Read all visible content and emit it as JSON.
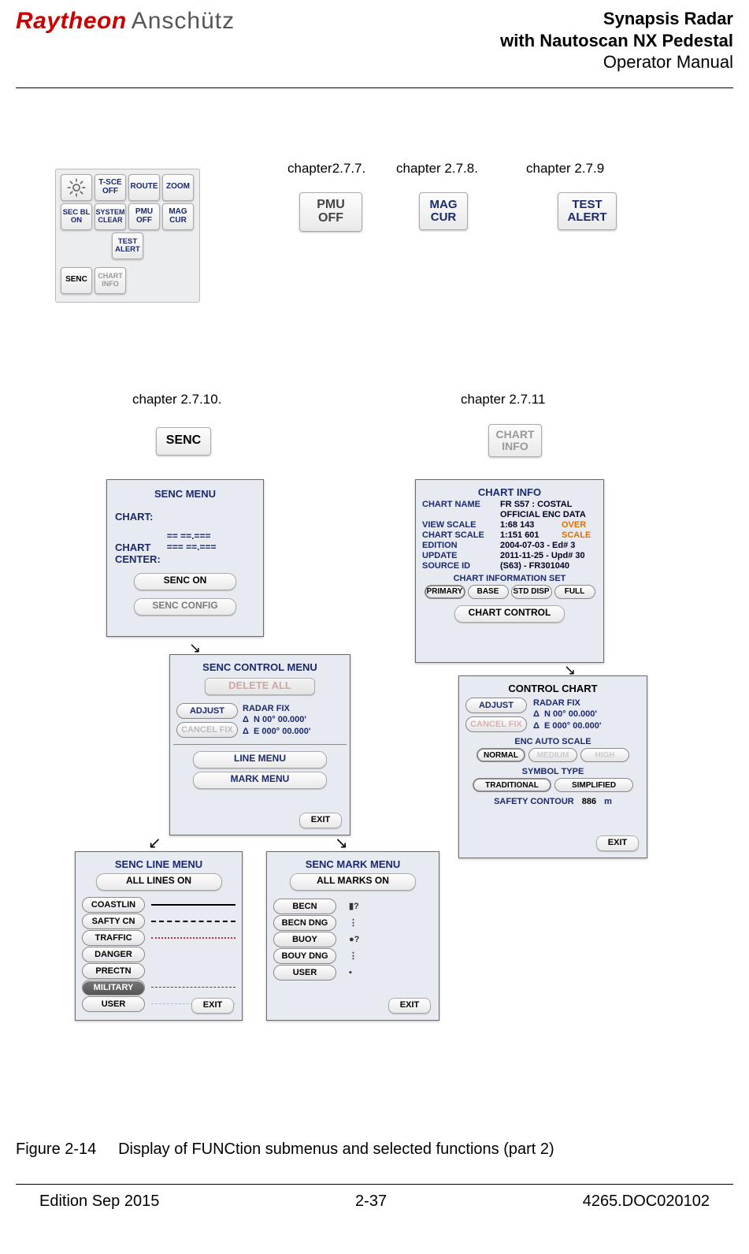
{
  "header": {
    "logo_left": "Raytheon",
    "logo_right": "Anschütz",
    "title_l1": "Synapsis Radar",
    "title_l2": "with Nautoscan NX Pedestal",
    "title_l3": "Operator Manual"
  },
  "labels": {
    "c277": "chapter2.7.7.",
    "c278": "chapter 2.7.8.",
    "c279": "chapter 2.7.9",
    "c2710": "chapter 2.7.10.",
    "c2711": "chapter 2.7.11"
  },
  "func_panel": {
    "r1": [
      "",
      "T-SCE\nOFF",
      "ROUTE",
      "ZOOM"
    ],
    "r2": [
      "SEC BL\nON",
      "SYSTEM\nCLEAR",
      "PMU\nOFF",
      "MAG\nCUR"
    ],
    "r3_center": "TEST\nALERT",
    "r4_left": "SENC",
    "r4_right": "CHART\nINFO"
  },
  "standalone": {
    "pmu": "PMU\nOFF",
    "mag": "MAG\nCUR",
    "test": "TEST\nALERT",
    "senc": "SENC",
    "chart": "CHART\nINFO"
  },
  "senc_menu": {
    "title": "SENC MENU",
    "chart_lbl": "CHART:",
    "center_lbl": "CHART\nCENTER:",
    "center_v1": "==  ==.===",
    "center_v2": "===  ==.===",
    "btn_on": "SENC ON",
    "btn_cfg": "SENC CONFIG"
  },
  "senc_ctrl": {
    "title": "SENC CONTROL MENU",
    "delete": "DELETE ALL",
    "adjust": "ADJUST",
    "cancel": "CANCEL FIX",
    "radar_fix": "RADAR FIX",
    "lat": "N 00° 00.000'",
    "lon": "E 000° 00.000'",
    "delta": "Δ",
    "line_menu": "LINE MENU",
    "mark_menu": "MARK MENU",
    "exit": "EXIT"
  },
  "chart_info": {
    "title": "CHART INFO",
    "rows": {
      "name_k": "CHART NAME",
      "name_v": "FR S57 : COSTAL",
      "name_v2": "OFFICIAL ENC DATA",
      "view_k": "VIEW SCALE",
      "view_v": "1:68 143",
      "view_o": "OVER",
      "cscale_k": "CHART SCALE",
      "cscale_v": "1:151 601",
      "cscale_o": "SCALE",
      "ed_k": "EDITION",
      "ed_v": "2004-07-03 - Ed#   3",
      "up_k": "UPDATE",
      "up_v": "2011-11-25 - Upd# 30",
      "src_k": "SOURCE ID",
      "src_v": "(S63) - FR301040"
    },
    "sect": "CHART INFORMATION SET",
    "seg": [
      "PRIMARY",
      "BASE",
      "STD DISP",
      "FULL"
    ],
    "cc_btn": "CHART CONTROL"
  },
  "ctrl_chart": {
    "title": "CONTROL CHART",
    "adjust": "ADJUST",
    "cancel": "CANCEL FIX",
    "radar_fix": "RADAR FIX",
    "lat": "N 00° 00.000'",
    "lon": "E 000° 00.000'",
    "delta": "Δ",
    "auto_scale_lbl": "ENC AUTO SCALE",
    "seg3": [
      "NORMAL",
      "MEDIUM",
      "HIGH"
    ],
    "sym_lbl": "SYMBOL TYPE",
    "seg2": [
      "TRADITIONAL",
      "SIMPLIFIED"
    ],
    "safety_lbl": "SAFETY CONTOUR",
    "safety_val": "886",
    "safety_unit": "m",
    "exit": "EXIT"
  },
  "senc_line": {
    "title": "SENC LINE MENU",
    "all": "ALL LINES ON",
    "items": [
      "COASTLIN",
      "SAFTY CN",
      "TRAFFIC",
      "DANGER",
      "PRECTN",
      "MILITARY",
      "USER"
    ],
    "exit": "EXIT"
  },
  "senc_mark": {
    "title": "SENC MARK MENU",
    "all": "ALL MARKS ON",
    "items": [
      "BECN",
      "BECN DNG",
      "BUOY",
      "BOUY DNG",
      "USER"
    ],
    "symbols": [
      "▮?",
      "⋮",
      "●?",
      "⋮",
      "▪"
    ],
    "exit": "EXIT"
  },
  "caption": {
    "fig": "Figure 2-14",
    "text": "Display of FUNCtion submenus and selected functions (part 2)"
  },
  "footer": {
    "left": "Edition Sep 2015",
    "center": "2-37",
    "right": "4265.DOC020102"
  }
}
